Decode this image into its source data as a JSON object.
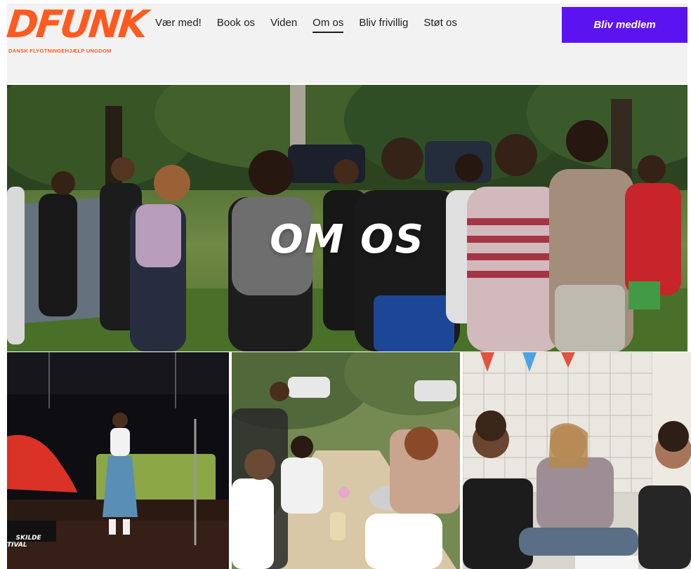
{
  "brand": {
    "logo_text": "DFUNK",
    "logo_subtitle": "DANSK FLYGTNINGEHJÆLP UNGDOM",
    "accent_color": "#ff5a1f",
    "cta_color": "#5b14f0"
  },
  "nav": {
    "items": [
      {
        "label": "Vær med!"
      },
      {
        "label": "Book os"
      },
      {
        "label": "Viden"
      },
      {
        "label": "Om os"
      },
      {
        "label": "Bliv frivillig"
      },
      {
        "label": "Støt os"
      }
    ],
    "active": "Om os",
    "cta_label": "Bliv medlem"
  },
  "hero": {
    "title": "OM OS"
  },
  "photos": {
    "stage_banner": "SKILDE\nTIVAL"
  }
}
